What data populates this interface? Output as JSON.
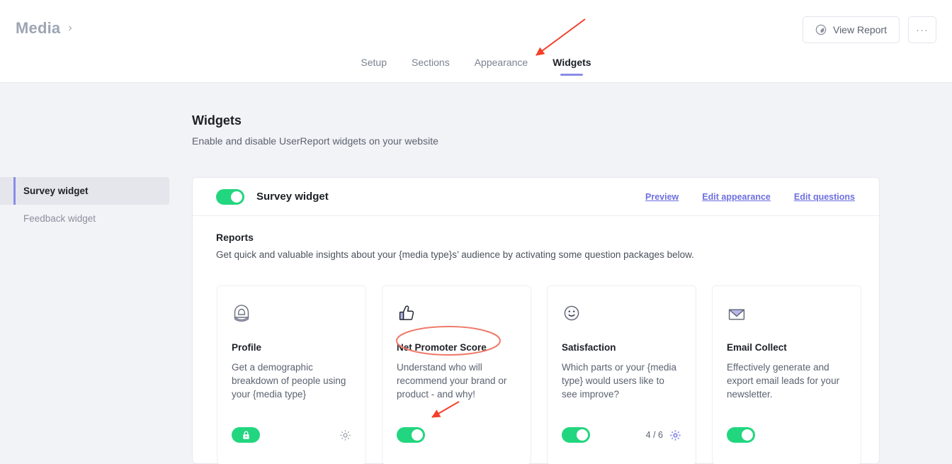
{
  "header": {
    "brand": "Media",
    "chevron": "›",
    "view_report_label": "View Report",
    "view_report_icon": "gauge-icon",
    "more_label": "···"
  },
  "tabs": [
    {
      "label": "Setup",
      "active": false
    },
    {
      "label": "Sections",
      "active": false
    },
    {
      "label": "Appearance",
      "active": false
    },
    {
      "label": "Widgets",
      "active": true
    }
  ],
  "page": {
    "title": "Widgets",
    "subtitle": "Enable and disable UserReport widgets on your website"
  },
  "sidebar": {
    "items": [
      {
        "label": "Survey widget",
        "active": true
      },
      {
        "label": "Feedback widget",
        "active": false
      }
    ]
  },
  "card": {
    "toggle_on": true,
    "title": "Survey widget",
    "links": [
      {
        "label": "Preview"
      },
      {
        "label": "Edit appearance"
      },
      {
        "label": "Edit questions"
      }
    ],
    "reports_title": "Reports",
    "reports_subtitle": "Get quick and valuable insights about your {media type}s’ audience by activating some question packages below."
  },
  "packages": [
    {
      "icon": "person-bust-icon",
      "title": "Profile",
      "description": "Get a demographic breakdown of people using your {media type}",
      "control": "lock-pill",
      "toggle_on": true,
      "count": "",
      "gear": "gear-icon",
      "gear_color": "#9aa0ac"
    },
    {
      "icon": "thumbs-up-icon",
      "title": "Net Promoter Score",
      "description": "Understand who will recommend your brand or product - and why!",
      "control": "toggle",
      "toggle_on": true,
      "count": "",
      "gear": "",
      "gear_color": ""
    },
    {
      "icon": "smiley-face-icon",
      "title": "Satisfaction",
      "description": "Which parts or your {media type} would users like to see improve?",
      "control": "toggle",
      "toggle_on": true,
      "count": "4 / 6",
      "gear": "gear-icon",
      "gear_color": "#8b8ce8"
    },
    {
      "icon": "envelope-icon",
      "title": "Email Collect",
      "description": "Effectively generate and export email leads for your newsletter.",
      "control": "toggle",
      "toggle_on": true,
      "count": "",
      "gear": "",
      "gear_color": ""
    }
  ],
  "colors": {
    "accent_purple": "#8b8ce8",
    "link_purple": "#6d6fe0",
    "toggle_green": "#22d67f",
    "annotation_red": "#f4402a",
    "annotation_ellipse": "#ef7b6a",
    "page_bg": "#f2f3f7"
  },
  "annotations": {
    "arrow_to_widgets_tab": "red-arrow",
    "ellipse_on_nps_title": "red-ellipse",
    "arrow_to_nps_toggle": "red-arrow"
  }
}
